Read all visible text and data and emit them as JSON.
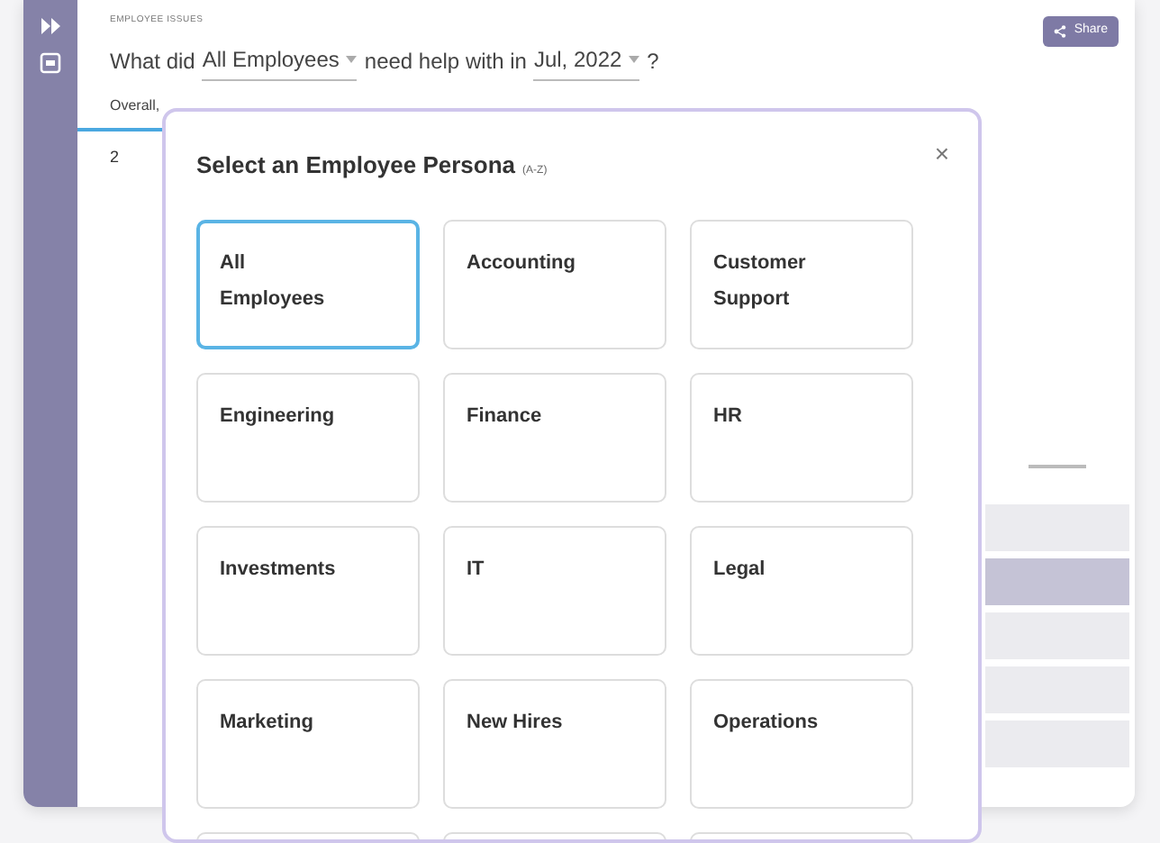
{
  "header": {
    "eyebrow": "EMPLOYEE ISSUES",
    "question": [
      {
        "kind": "text",
        "text": "What did"
      },
      {
        "kind": "dropdown",
        "text": "All Employees"
      },
      {
        "kind": "text",
        "text": "need help with in"
      },
      {
        "kind": "dropdown",
        "text": "Jul, 2022"
      },
      {
        "kind": "text",
        "text": "?"
      }
    ],
    "share": "Share"
  },
  "tab_label": "Overall,",
  "metric": "2",
  "side_rows": [
    {
      "selected": false
    },
    {
      "selected": true
    },
    {
      "selected": false
    },
    {
      "selected": false
    },
    {
      "selected": false
    }
  ],
  "modal": {
    "title": "Select an Employee Persona",
    "hint": "(A-Z)",
    "close": "×",
    "personas": [
      {
        "label": "All Employees",
        "selected": true
      },
      {
        "label": "Accounting",
        "selected": false
      },
      {
        "label": "Customer Support",
        "selected": false
      },
      {
        "label": "Engineering",
        "selected": false
      },
      {
        "label": "Finance",
        "selected": false
      },
      {
        "label": "HR",
        "selected": false
      },
      {
        "label": "Investments",
        "selected": false
      },
      {
        "label": "IT",
        "selected": false
      },
      {
        "label": "Legal",
        "selected": false
      },
      {
        "label": "Marketing",
        "selected": false
      },
      {
        "label": "New Hires",
        "selected": false
      },
      {
        "label": "Operations",
        "selected": false
      }
    ]
  }
}
